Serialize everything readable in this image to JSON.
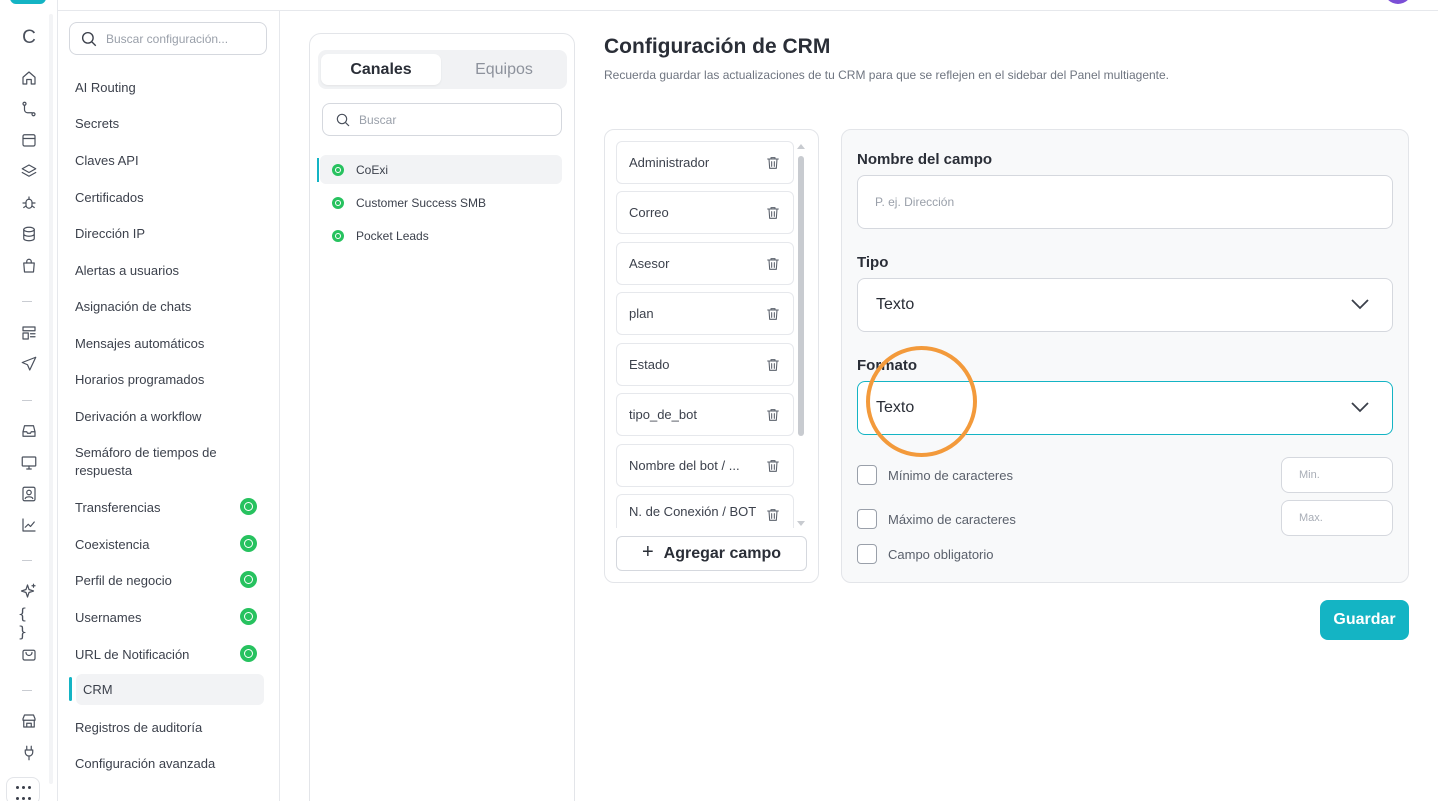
{
  "rail": {
    "top_letter": "C",
    "icons": [
      "home-icon",
      "flow-icon",
      "archive-icon",
      "layers-icon",
      "bug-icon",
      "database-icon",
      "bag-icon",
      "dashboard-icon",
      "send-icon",
      "inbox-icon",
      "monitor-icon",
      "contact-icon",
      "analytics-icon",
      "sparkle-icon",
      "code-braces-icon",
      "shopping-icon",
      "store-icon",
      "plug-icon",
      "apps-grid-icon"
    ],
    "code_label": "{ }"
  },
  "sidebar": {
    "search_placeholder": "Buscar configuración...",
    "items": [
      {
        "label": "AI Routing"
      },
      {
        "label": "Secrets"
      },
      {
        "label": "Claves API"
      },
      {
        "label": "Certificados"
      },
      {
        "label": "Dirección IP"
      },
      {
        "label": "Alertas a usuarios"
      },
      {
        "label": "Asignación de chats"
      },
      {
        "label": "Mensajes automáticos"
      },
      {
        "label": "Horarios programados"
      },
      {
        "label": "Derivación a workflow"
      },
      {
        "label": "Semáforo de tiempos de respuesta"
      },
      {
        "label": "Transferencias",
        "badge": "whatsapp-icon"
      },
      {
        "label": "Coexistencia",
        "badge": "whatsapp-icon"
      },
      {
        "label": "Perfil de negocio",
        "badge": "whatsapp-icon"
      },
      {
        "label": "Usernames",
        "badge": "whatsapp-icon"
      },
      {
        "label": "URL de Notificación",
        "badge": "whatsapp-icon"
      },
      {
        "label": "CRM",
        "active": true
      },
      {
        "label": "Registros de auditoría"
      },
      {
        "label": "Configuración avanzada"
      }
    ]
  },
  "channels": {
    "tabs": [
      {
        "label": "Canales",
        "active": true
      },
      {
        "label": "Equipos",
        "active": false
      }
    ],
    "search_placeholder": "Buscar",
    "items": [
      {
        "label": "CoExi",
        "active": true
      },
      {
        "label": "Customer Success SMB",
        "active": false
      },
      {
        "label": "Pocket Leads",
        "active": false
      }
    ]
  },
  "main": {
    "title": "Configuración de CRM",
    "subtitle": "Recuerda guardar las actualizaciones de tu CRM para que se reflejen en el sidebar del Panel multiagente."
  },
  "fields": {
    "items": [
      "Administrador",
      "Correo",
      "Asesor",
      "plan",
      "Estado",
      "tipo_de_bot",
      "Nombre del bot / ...",
      "N. de Conexión / BOT"
    ],
    "add_label": "Agregar campo"
  },
  "form": {
    "name_label": "Nombre del campo",
    "name_placeholder": "P. ej. Dirección",
    "type_label": "Tipo",
    "type_value": "Texto",
    "format_label": "Formato",
    "format_value": "Texto",
    "min_label": "Mínimo de caracteres",
    "min_placeholder": "Min.",
    "max_label": "Máximo de caracteres",
    "max_placeholder": "Max.",
    "required_label": "Campo obligatorio",
    "save_label": "Guardar"
  },
  "colors": {
    "accent": "#14b4c4",
    "whatsapp": "#27c25f",
    "highlight": "#f39a3b"
  }
}
